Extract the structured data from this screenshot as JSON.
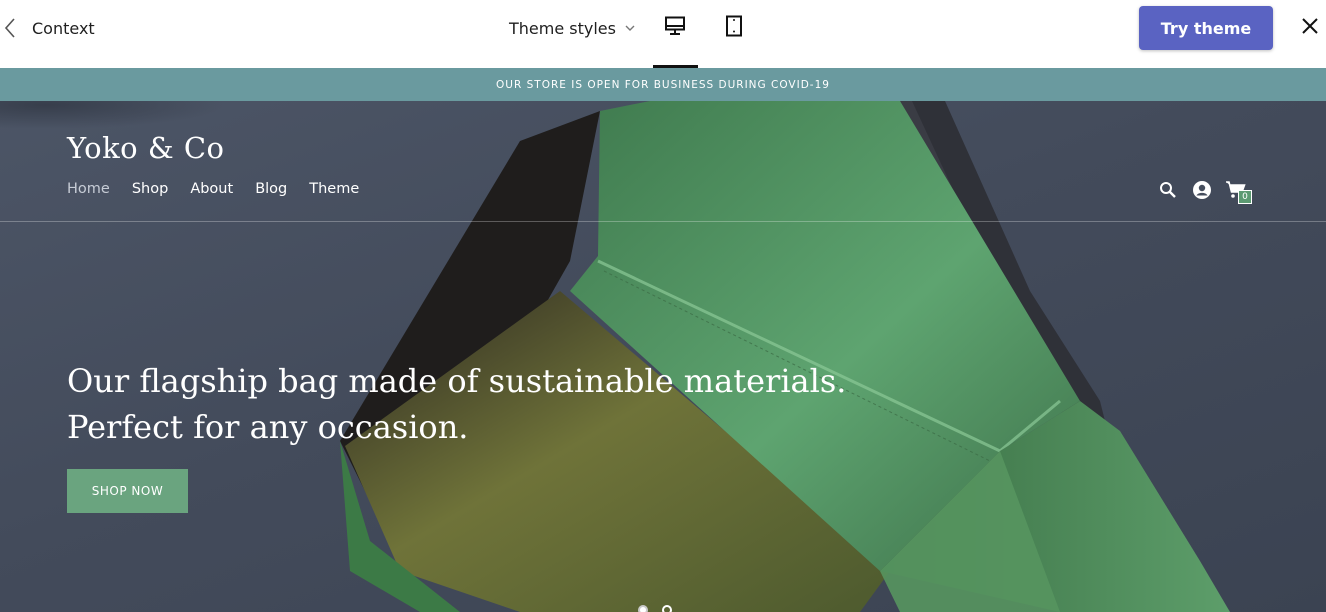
{
  "editor": {
    "back_label": "Context",
    "theme_styles_label": "Theme styles",
    "views": [
      {
        "name": "desktop",
        "icon": "desktop-icon",
        "active": true
      },
      {
        "name": "tablet",
        "icon": "tablet-icon",
        "active": false
      }
    ],
    "try_theme_label": "Try theme",
    "accent_color": "#5a63c2"
  },
  "store": {
    "announcement": "OUR STORE IS OPEN FOR BUSINESS DURING COVID-19",
    "announcement_bg": "#6a9a9f",
    "logo": "Yoko & Co",
    "nav": [
      "Home",
      "Shop",
      "About",
      "Blog",
      "Theme"
    ],
    "active_nav": "Home",
    "cart_count": "0",
    "header_icons": [
      "search-icon",
      "account-icon",
      "cart-icon"
    ],
    "hero": {
      "headline_line1": "Our flagship bag made of sustainable materials.",
      "headline_line2": "Perfect for any occasion.",
      "button_label": "SHOP NOW",
      "button_color": "#6aa47f"
    }
  }
}
